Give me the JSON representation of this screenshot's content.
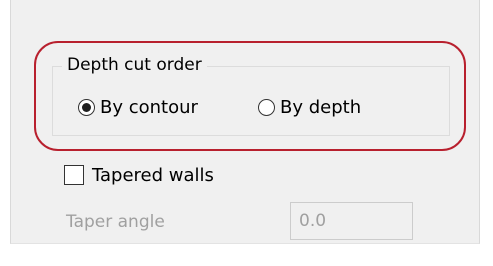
{
  "depth_cut_order": {
    "title": "Depth cut order",
    "options": [
      {
        "label": "By contour",
        "selected": true
      },
      {
        "label": "By depth",
        "selected": false
      }
    ]
  },
  "tapered_walls": {
    "label": "Tapered walls",
    "checked": false
  },
  "taper_angle": {
    "label": "Taper angle",
    "value": "0.0",
    "enabled": false
  },
  "colors": {
    "panel_background": "#f0f0f0",
    "highlight_annotation": "#b8202e",
    "disabled_text": "#a0a0a0"
  }
}
